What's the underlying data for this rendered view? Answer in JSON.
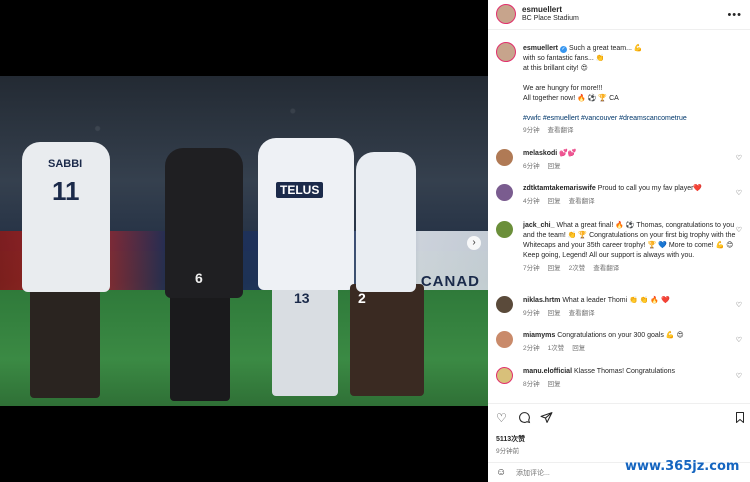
{
  "post": {
    "username": "esmuellert",
    "location": "BC Place Stadium",
    "caption_lines": [
      "Such a great team... 💪",
      "with so fantastic fans... 👏",
      "at this brillant city! 😍",
      "",
      "We are hungry for more!!!",
      "All together now! 🔥 ⚽ 🏆 CA"
    ],
    "hashtags": "#vwfc #esmuellert #vancouver #dreamscancometrue",
    "caption_time": "9分钟",
    "caption_translate": "查看翻译"
  },
  "image": {
    "jersey_back": "SABBI",
    "jersey_number": "11",
    "sponsor": "TELUS",
    "board_text": "CANAD",
    "number_13": "13",
    "number_6": "6",
    "number_2": "2"
  },
  "comments": [
    {
      "user": "melaskodi",
      "text": "💕💕",
      "time": "6分钟",
      "reply": "回复",
      "likes": "",
      "translate": "",
      "avatar_color": "#b07a55"
    },
    {
      "user": "zdtktamtakemariswife",
      "text": "Proud to call you my fav player❤️",
      "time": "4分钟",
      "reply": "回复",
      "likes": "",
      "translate": "查看翻译",
      "avatar_color": "#7a5c8f"
    },
    {
      "user": "jack_chi_",
      "text": "What a great final! 🔥 ⚽ Thomas, congratulations to you and the team! 👏 🏆 Congratulations on your first big trophy with the Whitecaps and your 35th career trophy! 🏆 💙 More to come! 💪 😊 Keep going, Legend! All our support is always with you.",
      "time": "7分钟",
      "reply": "回复",
      "likes": "2次赞",
      "translate": "查看翻译",
      "avatar_color": "#6b8f3a"
    },
    {
      "user": "niklas.hrtm",
      "text": "What a leader Thomi 👏 👏 🔥 ❤️",
      "time": "9分钟",
      "reply": "回复",
      "likes": "",
      "translate": "查看翻译",
      "avatar_color": "#5a4a3a"
    },
    {
      "user": "miamyms",
      "text": "Congratulations on your 300 goals 💪 😍",
      "time": "2分钟",
      "reply": "回复",
      "likes": "1次赞",
      "translate": "",
      "avatar_color": "#c98a6a"
    },
    {
      "user": "manu.elofficial",
      "text": "Klasse Thomas! Congratulations",
      "time": "8分钟",
      "reply": "回复",
      "likes": "",
      "translate": "",
      "avatar_color": "#d8c07a"
    }
  ],
  "footer": {
    "likes": "5113次赞",
    "time_ago": "9分钟前",
    "comment_placeholder": "添加评论..."
  },
  "icons": {
    "like": "heart-outline-icon",
    "comment": "comment-icon",
    "share": "paper-plane-icon",
    "save": "bookmark-icon",
    "more": "more-dots-icon",
    "next": "chevron-right-icon",
    "emoji": "emoji-icon"
  },
  "colors": {
    "verified": "#3897f0",
    "hashtag": "#00376b",
    "muted": "#737373",
    "story_ring": "#e1306c",
    "watermark": "#1565c0"
  },
  "watermark": "www.365jz.com"
}
